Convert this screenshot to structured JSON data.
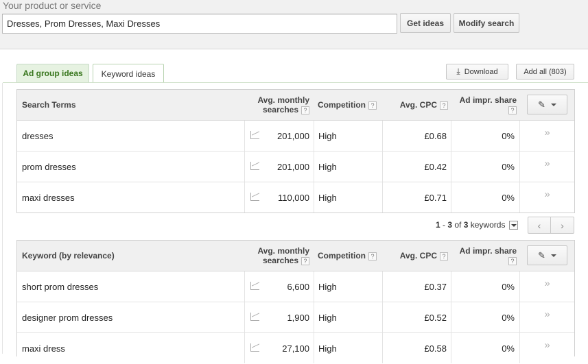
{
  "search": {
    "label": "Your product or service",
    "value": "Dresses, Prom Dresses, Maxi Dresses",
    "get_ideas": "Get ideas",
    "modify": "Modify search"
  },
  "tabs": [
    {
      "label": "Ad group ideas",
      "active": false
    },
    {
      "label": "Keyword ideas",
      "active": true
    }
  ],
  "actions": {
    "download": "Download",
    "add_all": "Add all (803)"
  },
  "headers": {
    "search_terms": "Search Terms",
    "keyword_relevance": "Keyword (by relevance)",
    "avg_line1": "Avg. monthly",
    "avg_line2": "searches",
    "competition": "Competition",
    "cpc": "Avg. CPC",
    "share_line1": "Ad impr. share",
    "help": "?"
  },
  "search_rows": [
    {
      "term": "dresses",
      "avg": "201,000",
      "competition": "High",
      "cpc": "£0.68",
      "share": "0%"
    },
    {
      "term": "prom dresses",
      "avg": "201,000",
      "competition": "High",
      "cpc": "£0.42",
      "share": "0%"
    },
    {
      "term": "maxi dresses",
      "avg": "110,000",
      "competition": "High",
      "cpc": "£0.71",
      "share": "0%"
    }
  ],
  "pager": {
    "range_start": "1",
    "range_sep": " - ",
    "range_end": "3",
    "of": " of ",
    "total": "3",
    "suffix": " keywords"
  },
  "keyword_rows": [
    {
      "term": "short prom dresses",
      "avg": "6,600",
      "competition": "High",
      "cpc": "£0.37",
      "share": "0%"
    },
    {
      "term": "designer prom dresses",
      "avg": "1,900",
      "competition": "High",
      "cpc": "£0.52",
      "share": "0%"
    },
    {
      "term": "maxi dress",
      "avg": "27,100",
      "competition": "High",
      "cpc": "£0.58",
      "share": "0%"
    }
  ],
  "icons": {
    "add": "»",
    "pager_prev": "‹",
    "pager_next": "›"
  }
}
